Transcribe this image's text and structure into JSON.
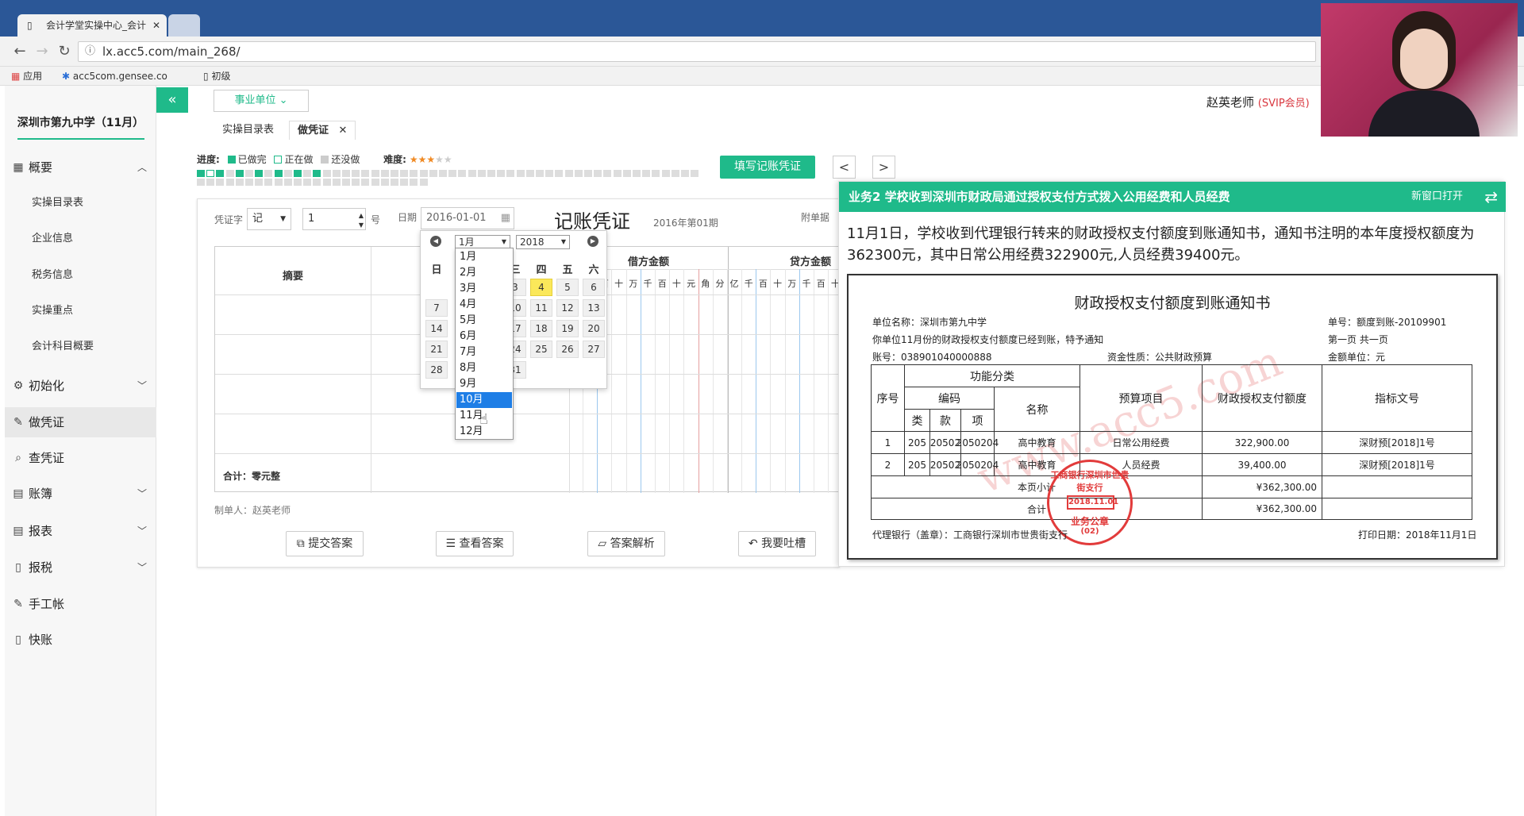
{
  "browser": {
    "tab_title": "会计学堂实操中心_会计",
    "url": "lx.acc5.com/main_268/",
    "bookmarks": [
      "应用",
      "acc5com.gensee.co",
      "初级"
    ]
  },
  "sidebar": {
    "school": "深圳市第九中学（11月）",
    "items": [
      {
        "label": "概要",
        "icon": "grid-icon"
      },
      {
        "label": "初始化",
        "icon": "gear-icon"
      },
      {
        "label": "做凭证",
        "icon": "pencil-icon"
      },
      {
        "label": "查凭证",
        "icon": "search-icon"
      },
      {
        "label": "账簿",
        "icon": "book-icon"
      },
      {
        "label": "报表",
        "icon": "report-icon"
      },
      {
        "label": "报税",
        "icon": "file-icon"
      },
      {
        "label": "手工帐",
        "icon": "pencil-icon"
      },
      {
        "label": "快账",
        "icon": "file-icon"
      }
    ],
    "subitems": [
      "实操目录表",
      "企业信息",
      "税务信息",
      "实操重点",
      "会计科目概要"
    ]
  },
  "header": {
    "collapse_label": "«",
    "unit_label": "事业单位",
    "teacher": "赵英老师",
    "vip": "(SVIP会员)",
    "tabs": [
      "实操目录表",
      "做凭证"
    ]
  },
  "progress": {
    "label": "进度:",
    "done": "已做完",
    "doing": "正在做",
    "todo": "还没做",
    "difficulty_label": "难度:",
    "difficulty_level": 3,
    "difficulty_max": 5
  },
  "toolbar": {
    "fill_label": "填写记账凭证",
    "prev": "<",
    "next": ">"
  },
  "voucher": {
    "word_label": "凭证字",
    "word_value": "记",
    "number_value": "1",
    "number_unit": "号",
    "date_label": "日期",
    "date_value": "2016-01-01",
    "title": "记账凭证",
    "period": "2016年第01期",
    "attach_label": "附单据",
    "summary_header": "摘要",
    "debit_header": "借方金额",
    "credit_header": "贷方金额",
    "digits": [
      "亿",
      "千",
      "百",
      "十",
      "万",
      "千",
      "百",
      "十",
      "元",
      "角",
      "分"
    ],
    "total": "合计：零元整",
    "maker": "制单人：赵英老师",
    "buttons": [
      "提交答案",
      "查看答案",
      "答案解析",
      "我要吐槽"
    ]
  },
  "datepicker": {
    "month": "1月",
    "year": "2018",
    "weekdays": [
      "日",
      "一",
      "二",
      "三",
      "四",
      "五",
      "六"
    ],
    "rows": [
      [
        "",
        "",
        "",
        "3",
        "4",
        "5",
        "6"
      ],
      [
        "7",
        "",
        "",
        "10",
        "11",
        "12",
        "13"
      ],
      [
        "14",
        "",
        "",
        "17",
        "18",
        "19",
        "20"
      ],
      [
        "21",
        "",
        "",
        "24",
        "25",
        "26",
        "27"
      ],
      [
        "28",
        "",
        "",
        "31",
        "",
        "",
        ""
      ]
    ],
    "months": [
      "1月",
      "2月",
      "3月",
      "4月",
      "5月",
      "6月",
      "7月",
      "8月",
      "9月",
      "10月",
      "11月",
      "12月"
    ],
    "selected_month": "10月"
  },
  "business": {
    "title": "业务2 学校收到深圳市财政局通过授权支付方式拨入公用经费和人员经费",
    "open_new": "新窗口打开",
    "text": "11月1日，学校收到代理银行转来的财政授权支付额度到账通知书，通知书注明的本年度授权额度为362300元，其中日常公用经费322900元,人员经费39400元。",
    "notice": {
      "title": "财政授权支付额度到账通知书",
      "unit": "单位名称：深圳市第九中学",
      "doc_no": "单号：额度到账-20109901",
      "line2": "你单位11月份的财政授权支付额度已经到账，特予通知",
      "page": "第一页  共一页",
      "account": "账号：038901040000888",
      "fund": "资金性质：公共财政预算",
      "money_unit": "金额单位：元",
      "h_seq": "序号",
      "h_func": "功能分类",
      "h_code": "编码",
      "h_name": "名称",
      "h_lei": "类",
      "h_kuan": "款",
      "h_xiang": "项",
      "h_budget": "预算项目",
      "h_amount": "财政授权支付额度",
      "h_doc": "指标文号",
      "rows": [
        {
          "seq": "1",
          "lei": "205",
          "kuan": "20502",
          "xiang": "2050204",
          "name": "高中教育",
          "budget": "日常公用经费",
          "amount": "322,900.00",
          "doc": "深财预[2018]1号"
        },
        {
          "seq": "2",
          "lei": "205",
          "kuan": "20502",
          "xiang": "2050204",
          "name": "高中教育",
          "budget": "人员经费",
          "amount": "39,400.00",
          "doc": "深财预[2018]1号"
        }
      ],
      "page_subtotal": "本页小计",
      "page_subtotal_value": "¥362,300.00",
      "total": "合计",
      "total_value": "¥362,300.00",
      "bank": "代理银行（盖章）：工商银行深圳市世贵街支行",
      "print_date": "打印日期：2018年11月1日",
      "stamp_arc": "工商银行深圳市世贵街支行",
      "stamp_date": "2018.11.01",
      "stamp_bottom": "业务公章",
      "stamp_num": "(02)",
      "watermark": "www.acc5.com"
    }
  },
  "colors": {
    "accent": "#1fba8a",
    "vip": "#d9363e",
    "selected": "#1e7ee6",
    "stamp": "#e23b3b"
  }
}
